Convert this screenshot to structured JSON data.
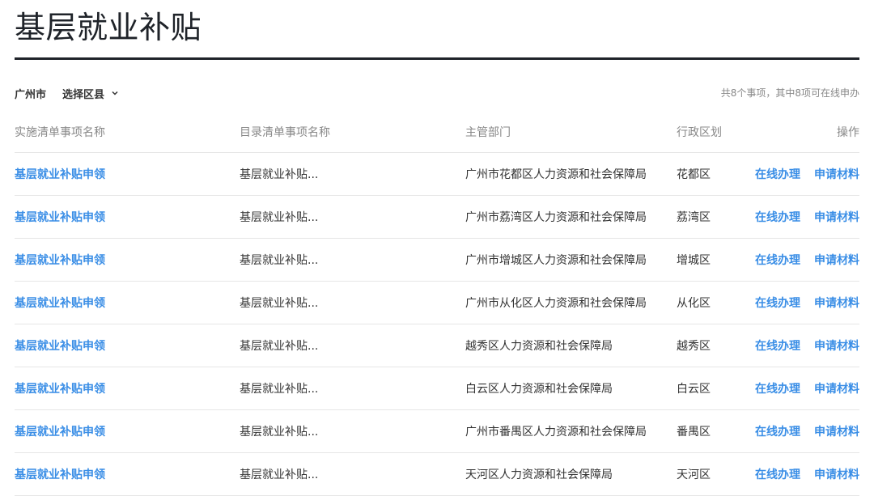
{
  "page": {
    "title": "基层就业补贴"
  },
  "filters": {
    "city": "广州市",
    "district": "选择区县"
  },
  "summary": "共8个事项，其中8项可在线申办",
  "table": {
    "headers": [
      "实施清单事项名称",
      "目录清单事项名称",
      "主管部门",
      "行政区划",
      "操作"
    ],
    "rows": [
      {
        "name": "基层就业补贴申领",
        "catalog": "基层就业补贴...",
        "dept": "广州市花都区人力资源和社会保障局",
        "region": "花都区",
        "op_online": "在线办理",
        "op_materials": "申请材料"
      },
      {
        "name": "基层就业补贴申领",
        "catalog": "基层就业补贴...",
        "dept": "广州市荔湾区人力资源和社会保障局",
        "region": "荔湾区",
        "op_online": "在线办理",
        "op_materials": "申请材料"
      },
      {
        "name": "基层就业补贴申领",
        "catalog": "基层就业补贴...",
        "dept": "广州市增城区人力资源和社会保障局",
        "region": "增城区",
        "op_online": "在线办理",
        "op_materials": "申请材料"
      },
      {
        "name": "基层就业补贴申领",
        "catalog": "基层就业补贴...",
        "dept": "广州市从化区人力资源和社会保障局",
        "region": "从化区",
        "op_online": "在线办理",
        "op_materials": "申请材料"
      },
      {
        "name": "基层就业补贴申领",
        "catalog": "基层就业补贴...",
        "dept": "越秀区人力资源和社会保障局",
        "region": "越秀区",
        "op_online": "在线办理",
        "op_materials": "申请材料"
      },
      {
        "name": "基层就业补贴申领",
        "catalog": "基层就业补贴...",
        "dept": "白云区人力资源和社会保障局",
        "region": "白云区",
        "op_online": "在线办理",
        "op_materials": "申请材料"
      },
      {
        "name": "基层就业补贴申领",
        "catalog": "基层就业补贴...",
        "dept": "广州市番禺区人力资源和社会保障局",
        "region": "番禺区",
        "op_online": "在线办理",
        "op_materials": "申请材料"
      },
      {
        "name": "基层就业补贴申领",
        "catalog": "基层就业补贴...",
        "dept": "天河区人力资源和社会保障局",
        "region": "天河区",
        "op_online": "在线办理",
        "op_materials": "申请材料"
      }
    ]
  },
  "colors": {
    "link": "#3a8ee6",
    "title": "#1f2329",
    "muted": "#888888",
    "divider": "#e6e6e6"
  },
  "icons": {
    "district_dropdown": "chevron-down-icon"
  }
}
